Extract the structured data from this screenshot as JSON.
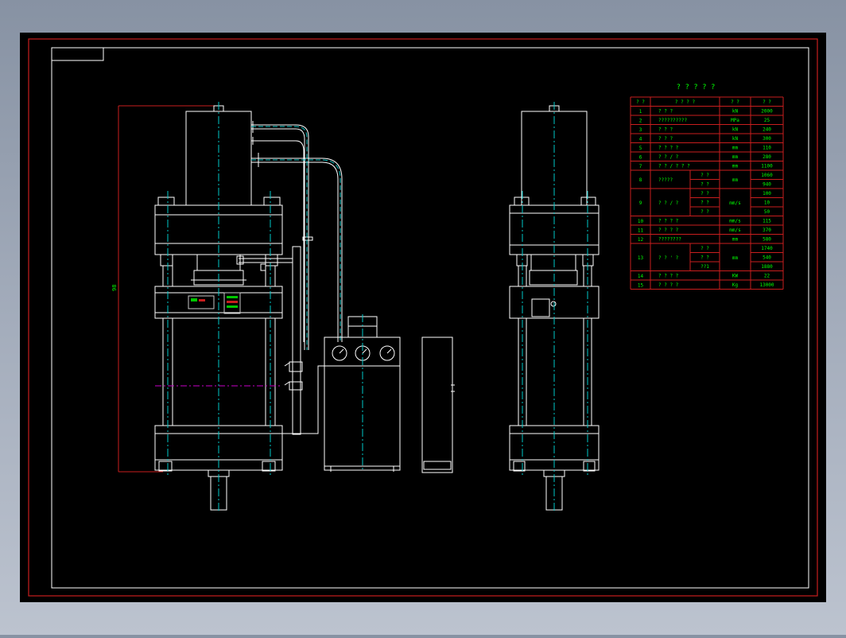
{
  "drawing": {
    "title_block_text": "",
    "dimension_height": "98",
    "table_title": "? ? ? ? ?",
    "table_header": [
      "? ?",
      "? ? ? ?",
      "? ?",
      "? ?"
    ],
    "table_rows": [
      {
        "no": "1",
        "name": "? ? ?",
        "unit": "kN",
        "value": "2000"
      },
      {
        "no": "2",
        "name": "??????????",
        "unit": "MPa",
        "value": "25"
      },
      {
        "no": "3",
        "name": "? ? ?",
        "unit": "kN",
        "value": "240"
      },
      {
        "no": "4",
        "name": "? ? ?",
        "unit": "kN",
        "value": "300"
      },
      {
        "no": "5",
        "name": "? ? ? ?",
        "unit": "mm",
        "value": "110"
      },
      {
        "no": "6",
        "name": "? ? / ?",
        "unit": "mm",
        "value": "280"
      },
      {
        "no": "7",
        "name": "? ? / ? ? ?",
        "unit": "mm",
        "value": "1100"
      },
      {
        "no": "8",
        "name": "?????",
        "subs": [
          "? ?",
          "? ?"
        ],
        "unit": "mm",
        "values": [
          "1060",
          "940"
        ]
      },
      {
        "no": "9",
        "name": "? ? / ?",
        "subs": [
          "? ?",
          "? ?",
          "? ?"
        ],
        "unit": "mm/s",
        "values": [
          "100",
          "10",
          "50"
        ]
      },
      {
        "no": "10",
        "name": "? ? ? ?",
        "unit": "mm/s",
        "value": "115"
      },
      {
        "no": "11",
        "name": "? ? ? ?",
        "unit": "mm/s",
        "value": "370"
      },
      {
        "no": "12",
        "name": "????????",
        "unit": "mm",
        "value": "580"
      },
      {
        "no": "13",
        "name": "? ? ' ?",
        "subs": [
          "? ?",
          "? ?",
          "??1"
        ],
        "unit": "mm",
        "values": [
          "1740",
          "540",
          "1880"
        ]
      },
      {
        "no": "14",
        "name": "? ? ? ?",
        "unit": "KW",
        "value": "22"
      },
      {
        "no": "15",
        "name": "? ? ? ?",
        "unit": "Kg",
        "value": "13000"
      }
    ],
    "colors": {
      "background": "#000000",
      "frame": "#c81e1e",
      "lines": "#ffffff",
      "centerlines": "#00c8c8",
      "text": "#00ff00",
      "cutline": "#c800c8"
    }
  }
}
